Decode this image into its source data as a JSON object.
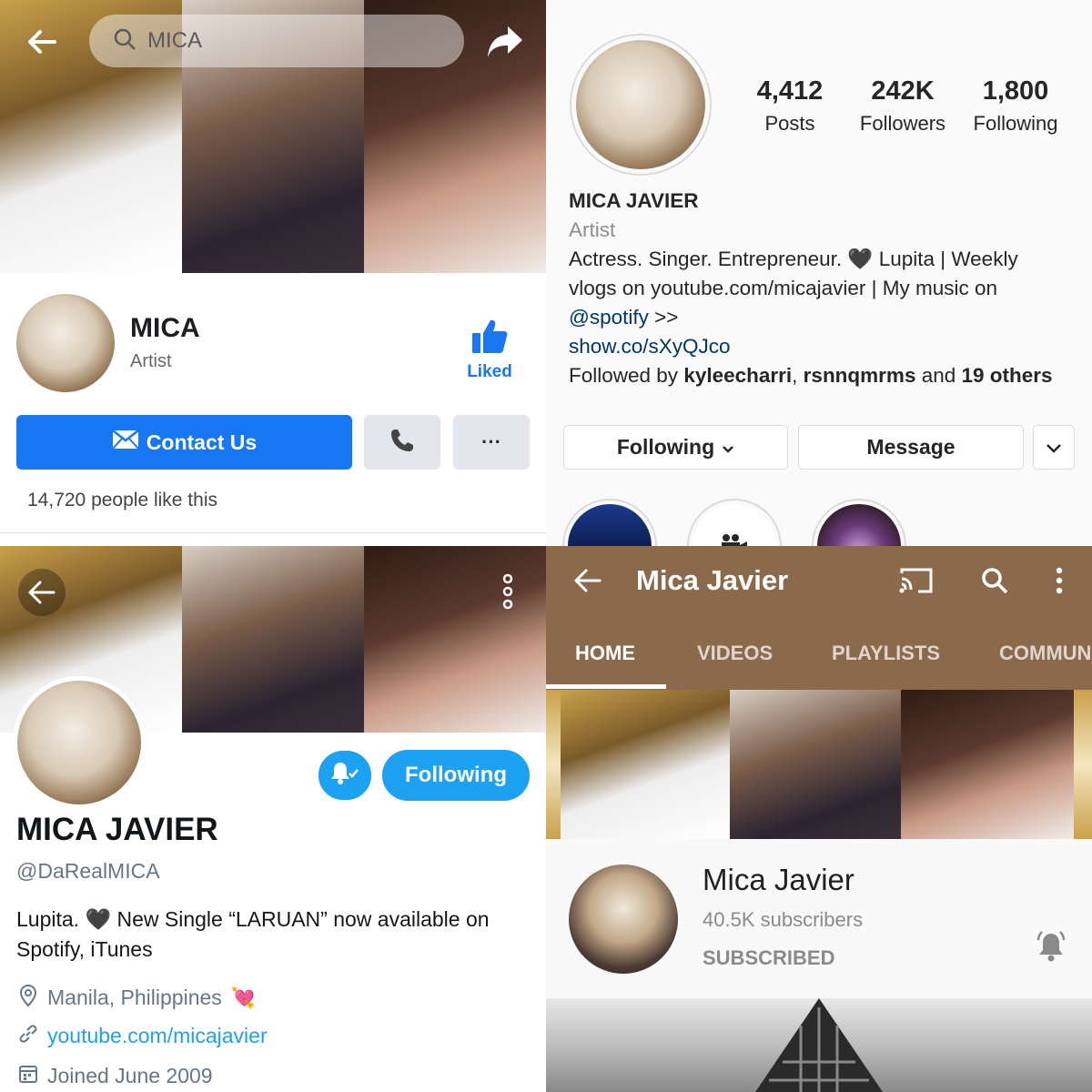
{
  "facebook": {
    "search_text": "MICA",
    "page_name": "MICA",
    "category": "Artist",
    "liked_label": "Liked",
    "contact_label": "Contact Us",
    "more_label": "···",
    "likes_text": "14,720 people like this",
    "icons": [
      "back-arrow-icon",
      "search-icon",
      "share-icon",
      "thumbs-up-icon",
      "envelope-icon",
      "phone-icon",
      "more-icon"
    ],
    "accent": "#1877f2"
  },
  "instagram": {
    "stats": [
      {
        "value": "4,412",
        "label": "Posts"
      },
      {
        "value": "242K",
        "label": "Followers"
      },
      {
        "value": "1,800",
        "label": "Following"
      }
    ],
    "name": "MICA JAVIER",
    "category": "Artist",
    "bio_line1_a": "Actress. Singer. Entrepreneur. ",
    "bio_heart": "🖤",
    "bio_line1_b": " Lupita | Weekly",
    "bio_line2": "vlogs on youtube.com/micajavier | My music on",
    "bio_mention": "@spotify",
    "bio_mention_suffix": " >>",
    "bio_link": "show.co/sXyQJco",
    "followed_prefix": "Followed by ",
    "followed_user1": "kyleecharri",
    "followed_sep": ", ",
    "followed_user2": "rsnnqmrms",
    "followed_mid": " and ",
    "followed_others": "19 others",
    "following_button": "Following",
    "message_button": "Message",
    "link_color": "#00376b"
  },
  "twitter": {
    "name": "MICA JAVIER",
    "handle": "@DaRealMICA",
    "bio_line1": "Lupita. 🖤 New Single “LARUAN” now available on",
    "bio_line2": "Spotify, iTunes",
    "location": "Manila, Philippines",
    "location_emoji": "💘",
    "website": "youtube.com/micajavier",
    "joined": "Joined June 2009",
    "following_button": "Following",
    "accent": "#1da1f2"
  },
  "youtube": {
    "title": "Mica Javier",
    "tabs": [
      "HOME",
      "VIDEOS",
      "PLAYLISTS",
      "COMMUN"
    ],
    "channel_name": "Mica Javier",
    "subscribers": "40.5K subscribers",
    "subscribed_label": "SUBSCRIBED",
    "header_color": "#8b6a4b"
  }
}
